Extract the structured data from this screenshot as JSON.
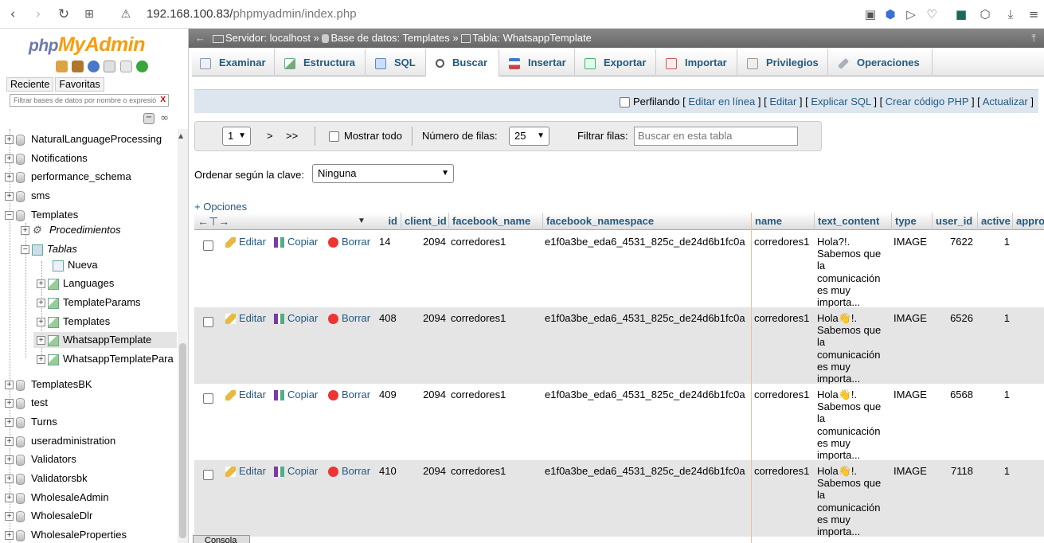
{
  "browser": {
    "url_host": "192.168.100.83/",
    "url_path": "phpmyadmin/index.php"
  },
  "sidebar": {
    "logo_php": "php",
    "logo_myadmin": "MyAdmin",
    "tab_recent": "Reciente",
    "tab_favorites": "Favoritas",
    "filter_placeholder": "Filtrar bases de datos por nombre o expresió",
    "filter_clear": "X",
    "tree": [
      "NaturalLanguageProcessing",
      "Notifications",
      "performance_schema",
      "sms",
      "Templates",
      "Procedimientos",
      "Tablas",
      "Nueva",
      "Languages",
      "TemplateParams",
      "Templates",
      "WhatsappTemplate",
      "WhatsappTemplatePara",
      "TemplatesBK",
      "test",
      "Turns",
      "useradministration",
      "Validators",
      "Validatorsbk",
      "WholesaleAdmin",
      "WholesaleDlr",
      "WholesaleProperties"
    ]
  },
  "breadcrumb": {
    "server": "Servidor: localhost",
    "sep1": "»",
    "database": "Base de datos: Templates",
    "sep2": "»",
    "table": "Tabla: WhatsappTemplate"
  },
  "tabs": [
    "Examinar",
    "Estructura",
    "SQL",
    "Buscar",
    "Insertar",
    "Exportar",
    "Importar",
    "Privilegios",
    "Operaciones"
  ],
  "profiling": {
    "label": "Perfilando",
    "links": [
      "Editar en línea",
      "Editar",
      "Explicar SQL",
      "Crear código PHP",
      "Actualizar"
    ]
  },
  "nav": {
    "page": "1",
    "next": ">",
    "last": ">>",
    "show_all": "Mostrar todo",
    "rows_label": "Número de filas:",
    "rows_value": "25",
    "filter_label": "Filtrar filas:",
    "filter_placeholder": "Buscar en esta tabla"
  },
  "sort": {
    "label": "Ordenar según la clave:",
    "value": "Ninguna"
  },
  "options_link": "+ Opciones",
  "columns": [
    "id",
    "client_id",
    "facebook_name",
    "facebook_namespace",
    "name",
    "text_content",
    "type",
    "user_id",
    "active",
    "appro"
  ],
  "actions": {
    "edit": "Editar",
    "copy": "Copiar",
    "delete": "Borrar"
  },
  "rows": [
    {
      "id": "14",
      "client_id": "2094",
      "facebook_name": "corredores1",
      "facebook_namespace": "e1f0a3be_eda6_4531_825c_de24d6b1fc0a",
      "name": "corredores1",
      "text_content": "Hola?!. Sabemos que la comunicación es muy importa...",
      "type": "IMAGE",
      "user_id": "7622",
      "active": "1"
    },
    {
      "id": "408",
      "client_id": "2094",
      "facebook_name": "corredores1",
      "facebook_namespace": "e1f0a3be_eda6_4531_825c_de24d6b1fc0a",
      "name": "corredores1",
      "text_content": "Hola👋!. Sabemos que la comunicación es muy importa...",
      "type": "IMAGE",
      "user_id": "6526",
      "active": "1"
    },
    {
      "id": "409",
      "client_id": "2094",
      "facebook_name": "corredores1",
      "facebook_namespace": "e1f0a3be_eda6_4531_825c_de24d6b1fc0a",
      "name": "corredores1",
      "text_content": "Hola👋!. Sabemos que la comunicación es muy importa...",
      "type": "IMAGE",
      "user_id": "6568",
      "active": "1"
    },
    {
      "id": "410",
      "client_id": "2094",
      "facebook_name": "corredores1",
      "facebook_namespace": "e1f0a3be_eda6_4531_825c_de24d6b1fc0a",
      "name": "corredores1",
      "text_content": "Hola👋!. Sabemos que la comunicación es muy importa...",
      "type": "IMAGE",
      "user_id": "7118",
      "active": "1"
    }
  ],
  "console_label": "Consola"
}
